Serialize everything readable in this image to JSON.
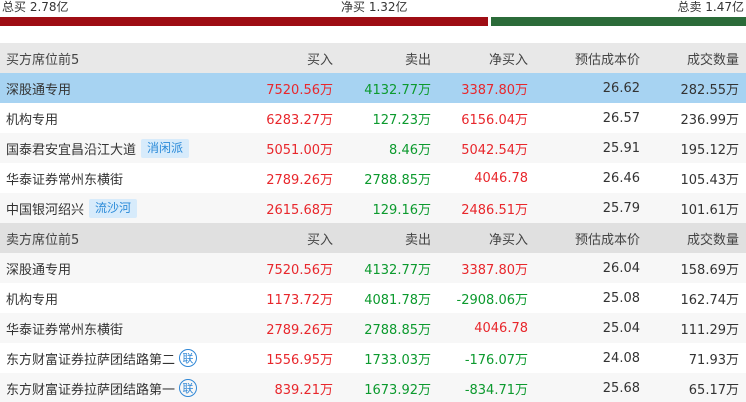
{
  "summary": {
    "total_buy": "总买 2.78亿",
    "net_buy": "净买 1.32亿",
    "total_sell": "总卖 1.47亿",
    "buy_ratio": 0.654,
    "colors": {
      "buy": "#9e0d14",
      "sell": "#2b6b39"
    }
  },
  "buy_section": {
    "headers": {
      "name": "买方席位前5",
      "buy": "买入",
      "sell": "卖出",
      "net": "净买入",
      "cost": "预估成本价",
      "volume": "成交数量"
    },
    "rows": [
      {
        "name": "深股通专用",
        "tag": "",
        "lian": "",
        "buy": "7520.56万",
        "sell": "4132.77万",
        "net": "3387.80万",
        "net_color": "red",
        "cost": "26.62",
        "volume": "282.55万"
      },
      {
        "name": "机构专用",
        "tag": "",
        "lian": "",
        "buy": "6283.27万",
        "sell": "127.23万",
        "net": "6156.04万",
        "net_color": "red",
        "cost": "26.57",
        "volume": "236.99万"
      },
      {
        "name": "国泰君安宜昌沿江大道",
        "tag": "消闲派",
        "lian": "",
        "buy": "5051.00万",
        "sell": "8.46万",
        "net": "5042.54万",
        "net_color": "red",
        "cost": "25.91",
        "volume": "195.12万"
      },
      {
        "name": "华泰证券常州东横街",
        "tag": "",
        "lian": "",
        "buy": "2789.26万",
        "sell": "2788.85万",
        "net": "4046.78",
        "net_color": "red",
        "cost": "26.46",
        "volume": "105.43万"
      },
      {
        "name": "中国银河绍兴",
        "tag": "流沙河",
        "lian": "",
        "buy": "2615.68万",
        "sell": "129.16万",
        "net": "2486.51万",
        "net_color": "red",
        "cost": "25.79",
        "volume": "101.61万"
      }
    ]
  },
  "sell_section": {
    "headers": {
      "name": "卖方席位前5",
      "buy": "买入",
      "sell": "卖出",
      "net": "净买入",
      "cost": "预估成本价",
      "volume": "成交数量"
    },
    "rows": [
      {
        "name": "深股通专用",
        "tag": "",
        "lian": "",
        "buy": "7520.56万",
        "sell": "4132.77万",
        "net": "3387.80万",
        "net_color": "red",
        "cost": "26.04",
        "volume": "158.69万"
      },
      {
        "name": "机构专用",
        "tag": "",
        "lian": "",
        "buy": "1173.72万",
        "sell": "4081.78万",
        "net": "-2908.06万",
        "net_color": "green",
        "cost": "25.08",
        "volume": "162.74万"
      },
      {
        "name": "华泰证券常州东横街",
        "tag": "",
        "lian": "",
        "buy": "2789.26万",
        "sell": "2788.85万",
        "net": "4046.78",
        "net_color": "red",
        "cost": "25.04",
        "volume": "111.29万"
      },
      {
        "name": "东方财富证券拉萨团结路第二",
        "tag": "",
        "lian": "联",
        "buy": "1556.95万",
        "sell": "1733.03万",
        "net": "-176.07万",
        "net_color": "green",
        "cost": "24.08",
        "volume": "71.93万"
      },
      {
        "name": "东方财富证券拉萨团结路第一",
        "tag": "",
        "lian": "联",
        "buy": "839.21万",
        "sell": "1673.92万",
        "net": "-834.71万",
        "net_color": "green",
        "cost": "25.68",
        "volume": "65.17万"
      }
    ]
  }
}
